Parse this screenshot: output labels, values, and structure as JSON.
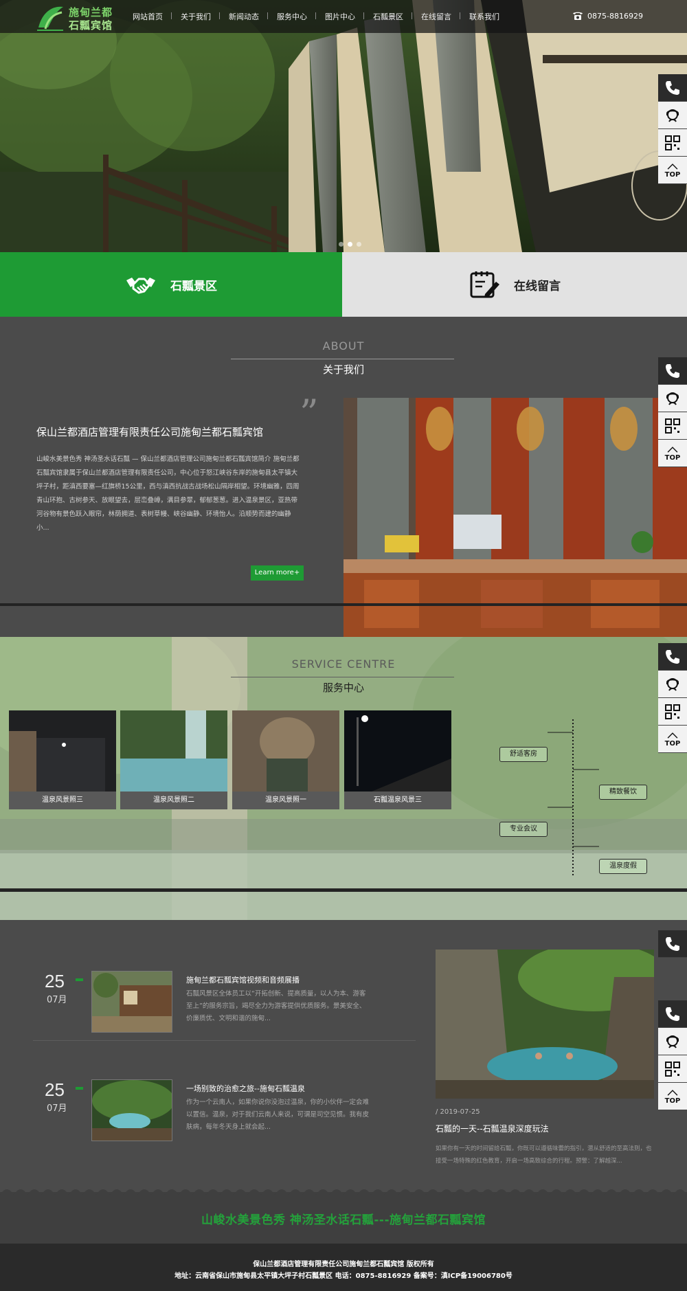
{
  "header": {
    "logo": {
      "line1": "施甸兰都",
      "line2": "石瓢宾馆"
    },
    "nav": [
      "网站首页",
      "关于我们",
      "新闻动态",
      "服务中心",
      "图片中心",
      "石瓢景区",
      "在线留言",
      "联系我们"
    ],
    "phone": "0875-8816929"
  },
  "hero": {
    "slides": 3,
    "active_slide": 2
  },
  "quick_links": {
    "scenic": "石瓢景区",
    "message": "在线留言"
  },
  "about": {
    "en": "ABOUT",
    "cn": "关于我们",
    "quote": "”",
    "title": "保山兰都酒店管理有限责任公司施甸兰都石瓢宾馆",
    "body": "山峻水美景色秀 神汤圣水话石瓢 — 保山兰都酒店管理公司施甸兰都石瓢宾馆简介 施甸兰都石瓢宾馆隶属于保山兰都酒店管理有限责任公司，中心位于怒江峡谷东岸的施甸县太平镇大坪子村，距滇西要塞—红旗桥15公里，西与滇西抗战古战场松山隔岸相望。环境幽雅，四周青山环抱、古树参天、放眼望去，层峦叠嶂，满目参翠，郁郁葱葱。进入温泉景区，亚热带河谷物有景色跃入眼帘，林荫拥道、表树草幔、峡谷幽静、环境怡人。沿顺势而建的幽静小...",
    "learn_more": "Learn more+"
  },
  "service": {
    "en": "SERVICE CENTRE",
    "cn": "服务中心",
    "cards": [
      "温泉风景照三",
      "温泉风景照二",
      "温泉风景照一",
      "石瓢温泉风景三"
    ],
    "tags": [
      "舒适客房",
      "精致餐饮",
      "专业会议",
      "温泉度假"
    ]
  },
  "news": {
    "items": [
      {
        "day": "25",
        "month": "07月",
        "title": "施甸兰都石瓢宾馆视频和音频展播",
        "body": "石瓢风景区全体员工以“开拓创新、提高质量，以人为本、游客至上”的服务宗旨，竭尽全力为游客提供优质服务。景美安全、价廉质优、文明和谐的施甸..."
      },
      {
        "day": "25",
        "month": "07月",
        "title": "一场别致的治愈之旅--施甸石瓢温泉",
        "body": "作为一个云南人，如果你说你没泡过温泉，你的小伙伴一定会难以置信。温泉，对于我们云南人来说，可谓是司空见惯。我有皮肤病，每年冬天身上就会起..."
      }
    ],
    "featured": {
      "date": "/ 2019-07-25",
      "title": "石瓢的一天--石瓢温泉深度玩法",
      "body": "如果你有一天的时间留给石瓢，你既可以遵循味蕾的指引，潜从舒适的至高法则，也接受一场特殊的红色教育，开启一场高致综合的行程。预警：了解越深..."
    }
  },
  "footer": {
    "slogan": "山峻水美景色秀 神汤圣水话石瓢---施甸兰都石瓢宾馆",
    "line1": "保山兰都酒店管理有限责任公司施甸兰都石瓢宾馆 版权所有",
    "line2": "地址：云南省保山市施甸县太平镇大坪子村石瓢景区 电话：0875-8816929 备案号：滇ICP备19006780号"
  },
  "float_bar": {
    "top_label": "TOP"
  },
  "colors": {
    "accent": "#1e9b34",
    "dark": "#4b4b4b",
    "footer": "#2a2a2a"
  }
}
